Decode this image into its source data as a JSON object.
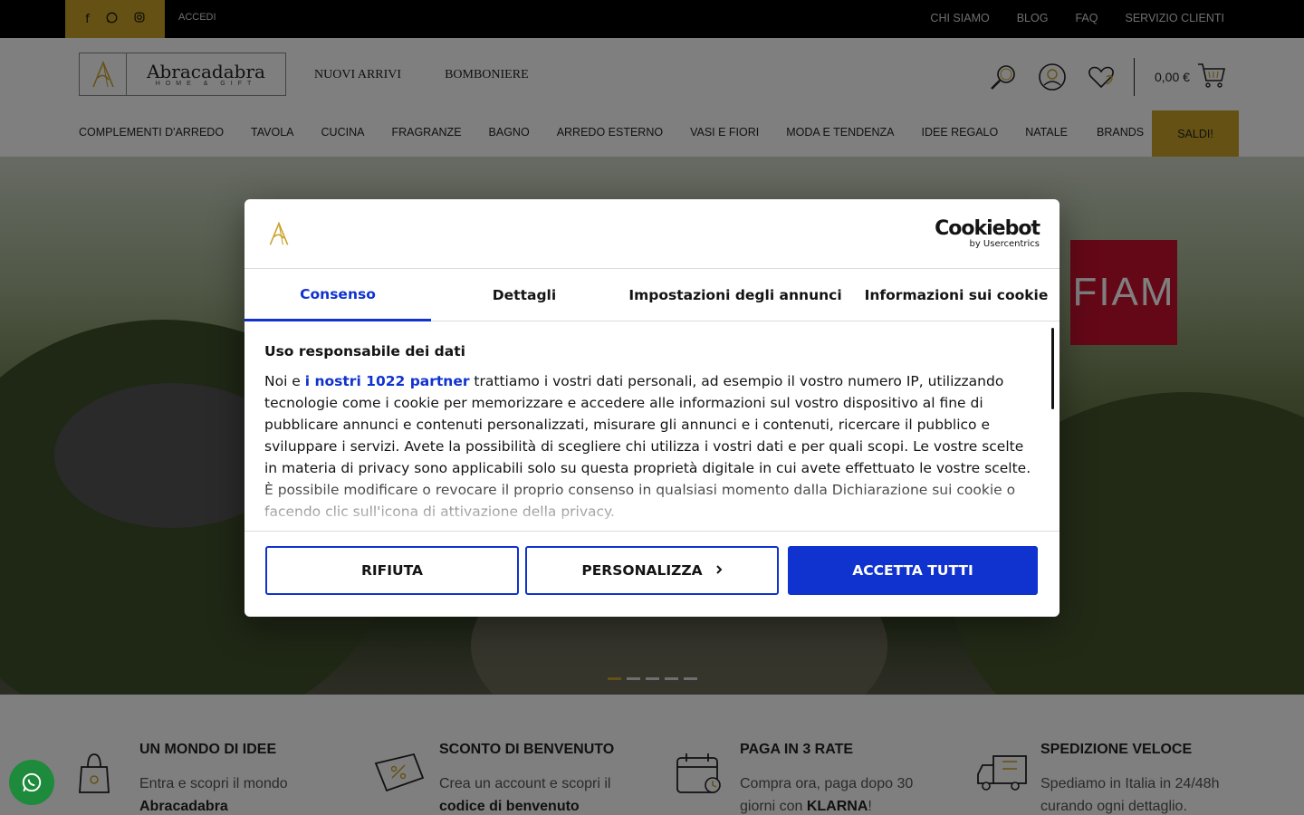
{
  "topbar": {
    "social_icons": [
      "facebook-icon",
      "whatsapp-icon",
      "instagram-icon"
    ],
    "login_label": "ACCEDI",
    "links": [
      "CHI SIAMO",
      "BLOG",
      "FAQ",
      "SERVIZIO CLIENTI"
    ]
  },
  "header": {
    "logo_name": "Abracadabra",
    "logo_subtitle": "HOME & GIFT",
    "nav": [
      "NUOVI ARRIVI",
      "BOMBONIERE"
    ],
    "cart_total": "0,00 €",
    "categories": [
      "COMPLEMENTI D'ARREDO",
      "TAVOLA",
      "CUCINA",
      "FRAGRANZE",
      "BAGNO",
      "ARREDO ESTERNO",
      "VASI E FIORI",
      "MODA E TENDENZA",
      "IDEE REGALO",
      "NATALE"
    ],
    "brands_label": "BRANDS",
    "sale_label": "SALDI!"
  },
  "hero": {
    "brand_logo": "FIAM",
    "slides": 5,
    "active_slide": 1
  },
  "features": [
    {
      "title": "UN MONDO DI IDEE",
      "text": "Entra e scopri il mondo ",
      "bold": "Abracadabra",
      "after": "",
      "icon": "shopping-bag-icon"
    },
    {
      "title": "SCONTO DI BENVENUTO",
      "text": "Crea un account e scopri il ",
      "bold": "codice di benvenuto",
      "after": "",
      "icon": "discount-tag-icon"
    },
    {
      "title": "PAGA IN 3 RATE",
      "text": "Compra ora, paga dopo 30 giorni con ",
      "bold": "KLARNA",
      "after": "!",
      "icon": "calendar-icon"
    },
    {
      "title": "SPEDIZIONE VELOCE",
      "text": "Spediamo in Italia in 24/48h curando ogni dettaglio.",
      "bold": "",
      "after": "",
      "icon": "delivery-truck-icon"
    }
  ],
  "cookie_dialog": {
    "provider": "Cookiebot",
    "provider_sub": "by Usercentrics",
    "tabs": [
      "Consenso",
      "Dettagli",
      "Impostazioni degli annunci",
      "Informazioni sui cookie"
    ],
    "active_tab": 0,
    "heading": "Uso responsabile dei dati",
    "body_before": "Noi e ",
    "partners_link": "i nostri 1022 partner",
    "body_after": " trattiamo i vostri dati personali, ad esempio il vostro numero IP, utilizzando tecnologie come i cookie per memorizzare e accedere alle informazioni sul vostro dispositivo al fine di pubblicare annunci e contenuti personalizzati, misurare gli annunci e i contenuti, ricercare il pubblico e sviluppare i servizi. Avete la possibilità di scegliere chi utilizza i vostri dati e per quali scopi. Le vostre scelte in materia di privacy sono applicabili solo su questa proprietà digitale in cui avete effettuato le vostre scelte. È possibile modificare o revocare il proprio consenso in qualsiasi momento dalla Dichiarazione sui cookie o facendo clic sull'icona di attivazione della privacy.",
    "btn_reject": "RIFIUTA",
    "btn_customize": "PERSONALIZZA",
    "btn_accept": "ACCETTA TUTTI",
    "accent_color": "#1032cf"
  },
  "colors": {
    "gold": "#c9a227",
    "whatsapp": "#1e8a3c"
  }
}
